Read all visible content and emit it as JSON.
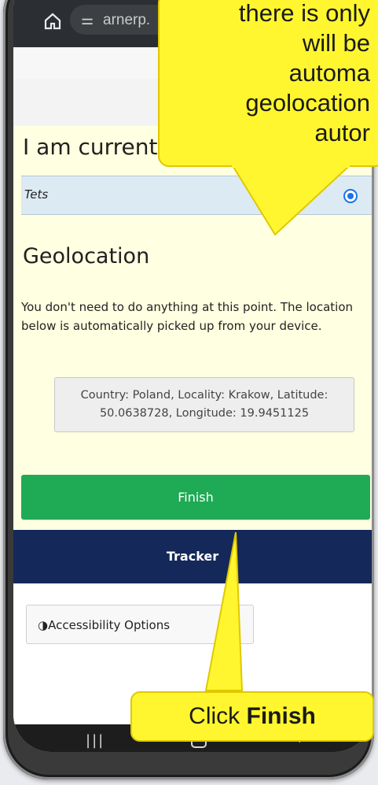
{
  "browser": {
    "url_text": "arnerp.",
    "home_icon": "home-icon",
    "site_settings_icon": "tune-icon"
  },
  "page": {
    "heading_current": "I am currently in",
    "option_label": "Tets",
    "geolocation_heading": "Geolocation",
    "geolocation_desc": "You don't need to do anything at this point. The location below is automatically picked up from your device.",
    "geolocation_value": "Country: Poland, Locality: Krakow, Latitude: 50.0638728, Longitude: 19.9451125",
    "finish_label": "Finish",
    "tracker_label": "Tracker",
    "accessibility_label": "Accessibility Options"
  },
  "callouts": {
    "top_lines": [
      "there is only",
      "will be",
      "automa",
      "geolocation",
      "autor"
    ],
    "bottom_prefix": "Click ",
    "bottom_bold": "Finish"
  },
  "colors": {
    "finish_green": "#1faa55",
    "tracker_navy": "#14285a",
    "callout_yellow": "#fff62f",
    "page_background": "#ffffe1"
  }
}
